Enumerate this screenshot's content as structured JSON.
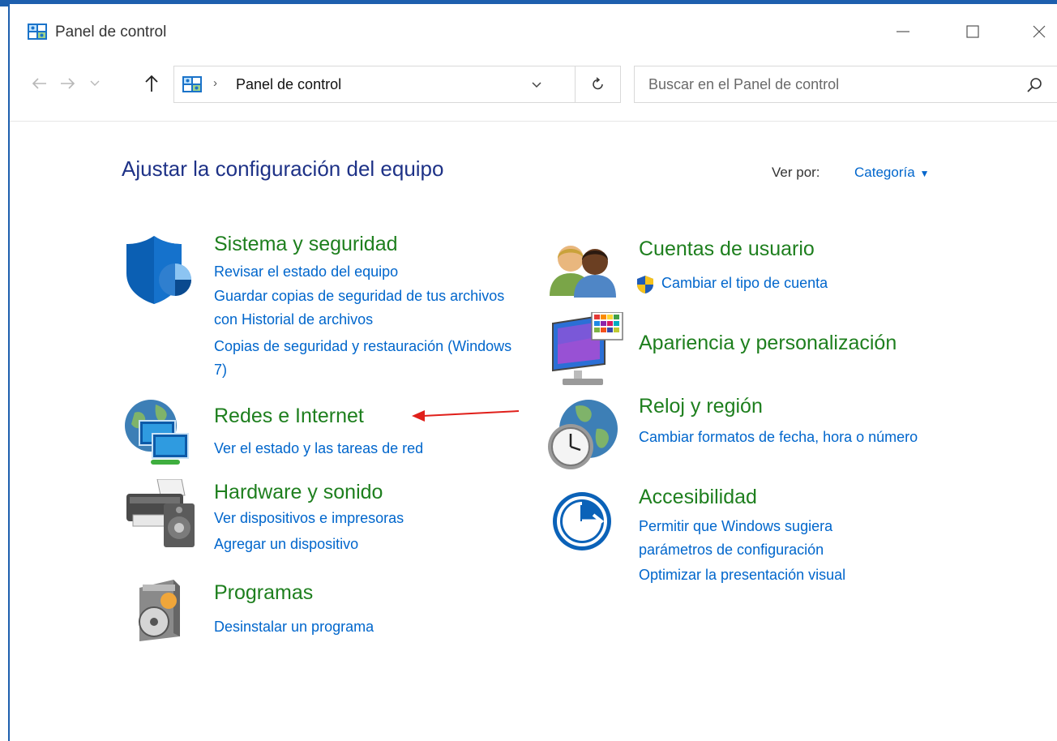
{
  "window": {
    "title": "Panel de control",
    "minimize_icon": "minimize-icon",
    "maximize_icon": "maximize-icon",
    "close_icon": "close-icon"
  },
  "nav": {
    "back_icon": "arrow-left-icon",
    "forward_icon": "arrow-right-icon",
    "recent_icon": "chevron-down-icon",
    "up_icon": "arrow-up-icon",
    "breadcrumb_separator": "›",
    "address": "Panel de control",
    "refresh_icon": "refresh-icon",
    "search_placeholder": "Buscar en el Panel de control"
  },
  "main": {
    "title": "Ajustar la configuración del equipo",
    "view_by_label": "Ver por:",
    "view_by_value": "Categoría"
  },
  "categories_left": [
    {
      "title": "Sistema y seguridad",
      "icon": "security-shield-icon",
      "links": [
        "Revisar el estado del equipo",
        "Guardar copias de seguridad de tus archivos con Historial de archivos",
        "Copias de seguridad y restauración (Windows 7)"
      ]
    },
    {
      "title": "Redes e Internet",
      "icon": "network-globe-icon",
      "links": [
        "Ver el estado y las tareas de red"
      ]
    },
    {
      "title": "Hardware y sonido",
      "icon": "printer-speaker-icon",
      "links": [
        "Ver dispositivos e impresoras",
        "Agregar un dispositivo"
      ]
    },
    {
      "title": "Programas",
      "icon": "programs-disc-icon",
      "links": [
        "Desinstalar un programa"
      ]
    }
  ],
  "categories_right": [
    {
      "title": "Cuentas de usuario",
      "icon": "user-accounts-icon",
      "links": [
        "Cambiar el tipo de cuenta"
      ]
    },
    {
      "title": "Apariencia y personalización",
      "icon": "appearance-monitor-icon",
      "links": []
    },
    {
      "title": "Reloj y región",
      "icon": "clock-globe-icon",
      "links": [
        "Cambiar formatos de fecha, hora o número"
      ]
    },
    {
      "title": "Accesibilidad",
      "icon": "accessibility-icon",
      "links": [
        "Permitir que Windows sugiera parámetros de configuración",
        "Optimizar la presentación visual"
      ]
    }
  ],
  "colors": {
    "window_border": "#1d5fae",
    "title_blue": "#1e3287",
    "category_green": "#1e7f1e",
    "link_blue": "#0066cc",
    "annotation_red": "#e0201b"
  }
}
